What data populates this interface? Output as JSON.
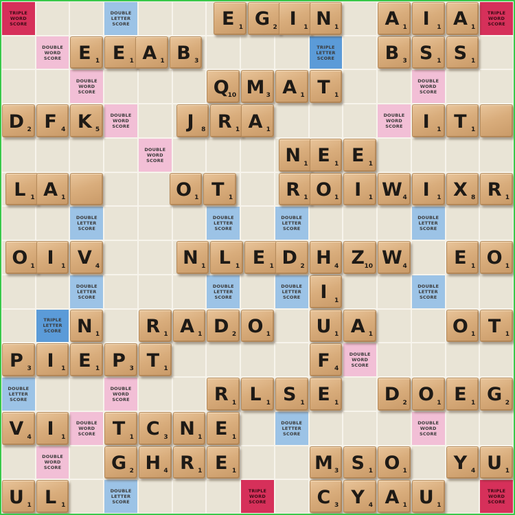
{
  "board": {
    "image_description_source": "photo",
    "colors": {
      "tile_wood": "#d9ad7c",
      "square_plain": "#e9e4d6",
      "double_letter": "#9cc3e6",
      "triple_letter": "#5b9bd8",
      "double_word": "#f2bfd6",
      "triple_word": "#d6305a",
      "frame_green": "#39c84a"
    },
    "premium_labels": {
      "DL": "DOUBLE LETTER SCORE",
      "TL": "TRIPLE LETTER SCORE",
      "DW": "DOUBLE WORD SCORE",
      "TW": "TRIPLE WORD SCORE"
    },
    "premium_squares": [
      {
        "type": "TW",
        "col": 0,
        "row": 0
      },
      {
        "type": "DL",
        "col": 3,
        "row": 0
      },
      {
        "type": "TW",
        "col": 14,
        "row": 0
      },
      {
        "type": "DW",
        "col": 1,
        "row": 1
      },
      {
        "type": "TL",
        "col": 9,
        "row": 1
      },
      {
        "type": "DW",
        "col": 2,
        "row": 2
      },
      {
        "type": "DW",
        "col": 12,
        "row": 2
      },
      {
        "type": "DW",
        "col": 3,
        "row": 3
      },
      {
        "type": "DW",
        "col": 11,
        "row": 3
      },
      {
        "type": "DW",
        "col": 4,
        "row": 4
      },
      {
        "type": "DL",
        "col": 2,
        "row": 6
      },
      {
        "type": "DL",
        "col": 6,
        "row": 6
      },
      {
        "type": "DL",
        "col": 8,
        "row": 6
      },
      {
        "type": "DL",
        "col": 12,
        "row": 6
      },
      {
        "type": "DL",
        "col": 2,
        "row": 8
      },
      {
        "type": "DL",
        "col": 6,
        "row": 8
      },
      {
        "type": "DL",
        "col": 8,
        "row": 8
      },
      {
        "type": "DL",
        "col": 12,
        "row": 8
      },
      {
        "type": "TL",
        "col": 1,
        "row": 9
      },
      {
        "type": "DW",
        "col": 10,
        "row": 10
      },
      {
        "type": "DL",
        "col": 0,
        "row": 11
      },
      {
        "type": "DW",
        "col": 3,
        "row": 11
      },
      {
        "type": "DW",
        "col": 2,
        "row": 12
      },
      {
        "type": "DL",
        "col": 8,
        "row": 12
      },
      {
        "type": "DW",
        "col": 12,
        "row": 12
      },
      {
        "type": "DW",
        "col": 1,
        "row": 13
      },
      {
        "type": "DL",
        "col": 3,
        "row": 14
      },
      {
        "type": "TW",
        "col": 7,
        "row": 14
      },
      {
        "type": "TW",
        "col": 14,
        "row": 14
      }
    ],
    "tiles": [
      {
        "l": "E",
        "p": "1",
        "col": 6.2,
        "row": 0
      },
      {
        "l": "G",
        "p": "2",
        "col": 7.2,
        "row": 0
      },
      {
        "l": "I",
        "p": "1",
        "col": 8.1,
        "row": 0
      },
      {
        "l": "N",
        "p": "1",
        "col": 9.0,
        "row": 0
      },
      {
        "l": "A",
        "p": "1",
        "col": 11.0,
        "row": 0
      },
      {
        "l": "I",
        "p": "1",
        "col": 12.0,
        "row": 0
      },
      {
        "l": "A",
        "p": "1",
        "col": 13.0,
        "row": 0
      },
      {
        "l": "E",
        "p": "1",
        "col": 2.0,
        "row": 1
      },
      {
        "l": "E",
        "p": "1",
        "col": 3.0,
        "row": 1
      },
      {
        "l": "A",
        "p": "1",
        "col": 3.9,
        "row": 1
      },
      {
        "l": "B",
        "p": "3",
        "col": 4.9,
        "row": 1
      },
      {
        "l": "B",
        "p": "3",
        "col": 11.0,
        "row": 1
      },
      {
        "l": "S",
        "p": "1",
        "col": 12.0,
        "row": 1
      },
      {
        "l": "S",
        "p": "1",
        "col": 13.0,
        "row": 1
      },
      {
        "l": "Q",
        "p": "10",
        "col": 6.0,
        "row": 2
      },
      {
        "l": "M",
        "p": "3",
        "col": 7.0,
        "row": 2
      },
      {
        "l": "A",
        "p": "1",
        "col": 8.0,
        "row": 2
      },
      {
        "l": "T",
        "p": "1",
        "col": 9.0,
        "row": 2
      },
      {
        "l": "D",
        "p": "2",
        "col": 0.0,
        "row": 3
      },
      {
        "l": "F",
        "p": "4",
        "col": 1.0,
        "row": 3
      },
      {
        "l": "K",
        "p": "5",
        "col": 2.0,
        "row": 3
      },
      {
        "l": "J",
        "p": "8",
        "col": 5.1,
        "row": 3
      },
      {
        "l": "R",
        "p": "1",
        "col": 6.1,
        "row": 3
      },
      {
        "l": "A",
        "p": "1",
        "col": 7.0,
        "row": 3
      },
      {
        "l": "I",
        "p": "1",
        "col": 12.0,
        "row": 3
      },
      {
        "l": "T",
        "p": "1",
        "col": 13.0,
        "row": 3
      },
      {
        "l": "",
        "p": "",
        "col": 14.0,
        "row": 3
      },
      {
        "l": "N",
        "p": "1",
        "col": 8.1,
        "row": 4
      },
      {
        "l": "E",
        "p": "1",
        "col": 9.0,
        "row": 4
      },
      {
        "l": "E",
        "p": "1",
        "col": 10.0,
        "row": 4
      },
      {
        "l": "L",
        "p": "1",
        "col": 0.1,
        "row": 5
      },
      {
        "l": "A",
        "p": "1",
        "col": 1.0,
        "row": 5
      },
      {
        "l": "",
        "p": "",
        "col": 2.0,
        "row": 5
      },
      {
        "l": "O",
        "p": "1",
        "col": 4.9,
        "row": 5
      },
      {
        "l": "T",
        "p": "1",
        "col": 5.9,
        "row": 5
      },
      {
        "l": "R",
        "p": "1",
        "col": 8.1,
        "row": 5
      },
      {
        "l": "O",
        "p": "1",
        "col": 9.0,
        "row": 5
      },
      {
        "l": "I",
        "p": "1",
        "col": 10.0,
        "row": 5
      },
      {
        "l": "W",
        "p": "4",
        "col": 11.0,
        "row": 5
      },
      {
        "l": "I",
        "p": "1",
        "col": 12.0,
        "row": 5
      },
      {
        "l": "X",
        "p": "8",
        "col": 13.0,
        "row": 5
      },
      {
        "l": "R",
        "p": "1",
        "col": 14.0,
        "row": 5
      },
      {
        "l": "O",
        "p": "1",
        "col": 0.1,
        "row": 7
      },
      {
        "l": "I",
        "p": "1",
        "col": 1.0,
        "row": 7
      },
      {
        "l": "V",
        "p": "4",
        "col": 2.0,
        "row": 7
      },
      {
        "l": "N",
        "p": "1",
        "col": 5.1,
        "row": 7
      },
      {
        "l": "L",
        "p": "1",
        "col": 6.1,
        "row": 7
      },
      {
        "l": "E",
        "p": "1",
        "col": 7.1,
        "row": 7
      },
      {
        "l": "D",
        "p": "2",
        "col": 8.0,
        "row": 7
      },
      {
        "l": "H",
        "p": "4",
        "col": 9.0,
        "row": 7
      },
      {
        "l": "Z",
        "p": "10",
        "col": 10.0,
        "row": 7
      },
      {
        "l": "W",
        "p": "4",
        "col": 11.0,
        "row": 7
      },
      {
        "l": "E",
        "p": "1",
        "col": 13.0,
        "row": 7
      },
      {
        "l": "O",
        "p": "1",
        "col": 14.0,
        "row": 7
      },
      {
        "l": "I",
        "p": "1",
        "col": 9.0,
        "row": 8
      },
      {
        "l": "N",
        "p": "1",
        "col": 2.0,
        "row": 9
      },
      {
        "l": "R",
        "p": "1",
        "col": 4.0,
        "row": 9
      },
      {
        "l": "A",
        "p": "1",
        "col": 5.0,
        "row": 9
      },
      {
        "l": "D",
        "p": "2",
        "col": 6.0,
        "row": 9
      },
      {
        "l": "O",
        "p": "1",
        "col": 7.0,
        "row": 9
      },
      {
        "l": "U",
        "p": "1",
        "col": 9.0,
        "row": 9
      },
      {
        "l": "A",
        "p": "1",
        "col": 10.0,
        "row": 9
      },
      {
        "l": "O",
        "p": "1",
        "col": 13.0,
        "row": 9
      },
      {
        "l": "T",
        "p": "1",
        "col": 14.0,
        "row": 9
      },
      {
        "l": "P",
        "p": "3",
        "col": 0.0,
        "row": 10
      },
      {
        "l": "I",
        "p": "1",
        "col": 1.0,
        "row": 10
      },
      {
        "l": "E",
        "p": "1",
        "col": 2.0,
        "row": 10
      },
      {
        "l": "P",
        "p": "3",
        "col": 3.0,
        "row": 10
      },
      {
        "l": "T",
        "p": "1",
        "col": 4.0,
        "row": 10
      },
      {
        "l": "F",
        "p": "4",
        "col": 9.0,
        "row": 10
      },
      {
        "l": "R",
        "p": "1",
        "col": 6.0,
        "row": 11
      },
      {
        "l": "L",
        "p": "1",
        "col": 7.0,
        "row": 11
      },
      {
        "l": "S",
        "p": "1",
        "col": 8.0,
        "row": 11
      },
      {
        "l": "E",
        "p": "1",
        "col": 9.0,
        "row": 11
      },
      {
        "l": "D",
        "p": "2",
        "col": 11.0,
        "row": 11
      },
      {
        "l": "O",
        "p": "1",
        "col": 12.0,
        "row": 11
      },
      {
        "l": "E",
        "p": "1",
        "col": 13.0,
        "row": 11
      },
      {
        "l": "G",
        "p": "2",
        "col": 14.0,
        "row": 11
      },
      {
        "l": "V",
        "p": "4",
        "col": 0.0,
        "row": 12
      },
      {
        "l": "I",
        "p": "1",
        "col": 1.0,
        "row": 12
      },
      {
        "l": "T",
        "p": "1",
        "col": 3.0,
        "row": 12
      },
      {
        "l": "C",
        "p": "3",
        "col": 4.0,
        "row": 12
      },
      {
        "l": "N",
        "p": "1",
        "col": 5.0,
        "row": 12
      },
      {
        "l": "E",
        "p": "1",
        "col": 6.0,
        "row": 12
      },
      {
        "l": "G",
        "p": "2",
        "col": 3.0,
        "row": 13
      },
      {
        "l": "H",
        "p": "4",
        "col": 4.0,
        "row": 13
      },
      {
        "l": "R",
        "p": "1",
        "col": 5.0,
        "row": 13
      },
      {
        "l": "E",
        "p": "1",
        "col": 6.0,
        "row": 13
      },
      {
        "l": "M",
        "p": "3",
        "col": 9.0,
        "row": 13
      },
      {
        "l": "S",
        "p": "1",
        "col": 10.0,
        "row": 13
      },
      {
        "l": "O",
        "p": "1",
        "col": 11.0,
        "row": 13
      },
      {
        "l": "Y",
        "p": "4",
        "col": 13.0,
        "row": 13
      },
      {
        "l": "U",
        "p": "1",
        "col": 14.0,
        "row": 13
      },
      {
        "l": "U",
        "p": "1",
        "col": 0.0,
        "row": 14
      },
      {
        "l": "L",
        "p": "1",
        "col": 1.0,
        "row": 14
      },
      {
        "l": "C",
        "p": "3",
        "col": 9.0,
        "row": 14
      },
      {
        "l": "Y",
        "p": "4",
        "col": 10.0,
        "row": 14
      },
      {
        "l": "A",
        "p": "1",
        "col": 11.0,
        "row": 14
      },
      {
        "l": "U",
        "p": "1",
        "col": 12.0,
        "row": 14
      }
    ]
  }
}
